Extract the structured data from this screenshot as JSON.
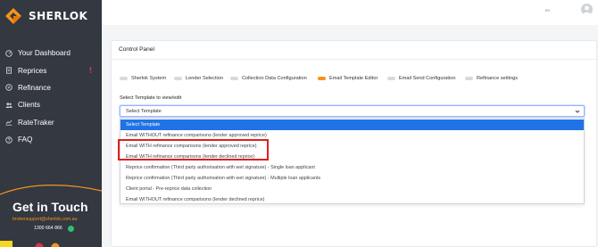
{
  "app": {
    "name": "SHERLOK",
    "brand_orange": "#f7921e",
    "sidebar_bg": "#333841"
  },
  "sidebar": {
    "items": [
      {
        "label": "Your Dashboard",
        "icon": "dashboard-icon"
      },
      {
        "label": "Reprices",
        "icon": "document-icon",
        "badge": "!"
      },
      {
        "label": "Refinance",
        "icon": "refinance-icon"
      },
      {
        "label": "Clients",
        "icon": "users-icon"
      },
      {
        "label": "RateTraker",
        "icon": "chart-icon"
      },
      {
        "label": "FAQ",
        "icon": "help-icon"
      }
    ],
    "contact": {
      "title": "Get in Touch",
      "email": "brokersupport@sherlok.com.au",
      "phone": "1300 664 866"
    }
  },
  "topbar": {
    "lang": "en"
  },
  "panel": {
    "title": "Control Panel",
    "tabs": [
      {
        "label": "Sherlok System",
        "active": false
      },
      {
        "label": "Lender Selection",
        "active": false
      },
      {
        "label": "Collection Data Configuration",
        "active": false
      },
      {
        "label": "Email Template Editor",
        "active": true
      },
      {
        "label": "Email Send Configuration",
        "active": false
      },
      {
        "label": "Refinance settings",
        "active": false
      }
    ],
    "select_label": "Select Template to view/edit",
    "select_value": "Select Template",
    "options": [
      "Select Template",
      "Email WITHOUT refinance comparisons (lender approved reprice)",
      "Email WITH refinance comparisons (lender approved reprice)",
      "Email WITH refinance comparisons (lender declined reprice)",
      "Reprice confirmation (Third party authorisation with wet signature) - Single loan applicant",
      "Reprice confirmation (Third party authorisation with wet signature) - Multiple loan applicants",
      "Client portal - Pre-reprice data collection",
      "Email WITHOUT refinance comparisons (lender declined reprice)"
    ]
  }
}
